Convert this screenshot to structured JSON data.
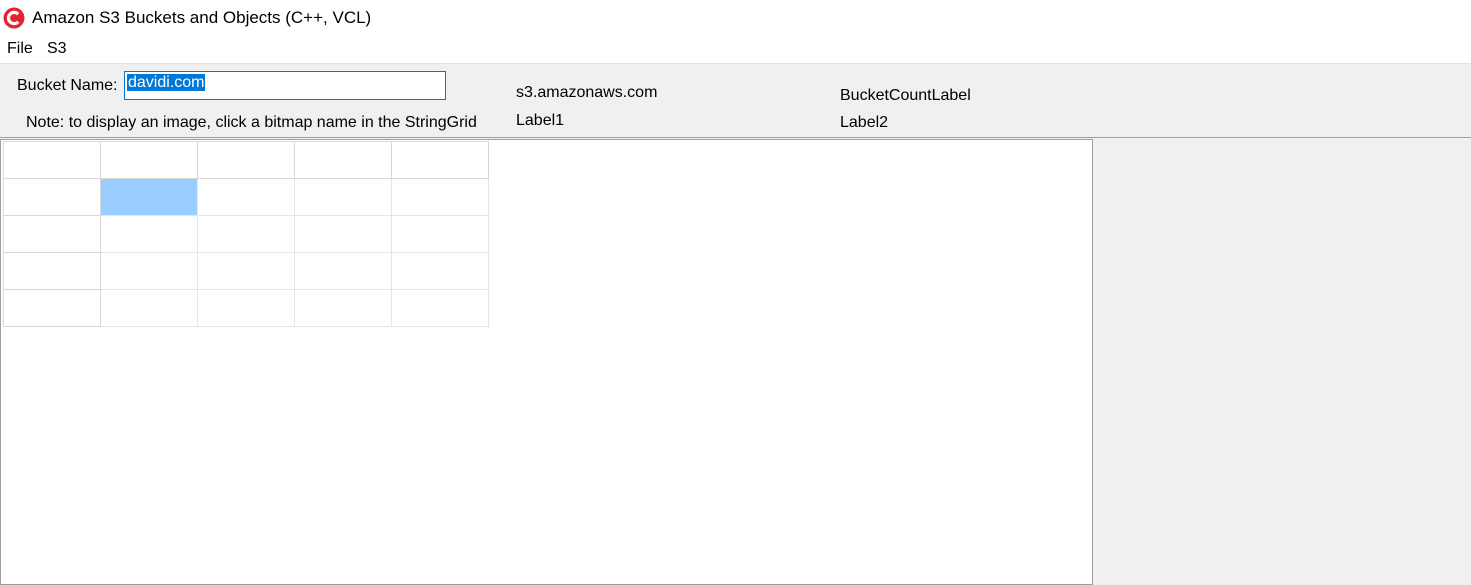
{
  "window": {
    "title": "Amazon S3 Buckets and Objects (C++, VCL)",
    "app_icon": "cbuilder-logo-icon",
    "accent_color": "#e62431"
  },
  "menu": {
    "items": [
      {
        "label": "File"
      },
      {
        "label": "S3"
      }
    ]
  },
  "top_panel": {
    "bucket_name_label": "Bucket Name:",
    "bucket_name_value": "davidi.com",
    "note": "Note: to display an image, click a bitmap name in the StringGrid",
    "host": "s3.amazonaws.com",
    "label1": "Label1",
    "bucket_count_label": "BucketCountLabel",
    "label2": "Label2"
  },
  "string_grid": {
    "rows": [
      [
        "",
        "",
        "",
        "",
        ""
      ],
      [
        "",
        "",
        "",
        "",
        ""
      ],
      [
        "",
        "",
        "",
        "",
        ""
      ],
      [
        "",
        "",
        "",
        "",
        ""
      ],
      [
        "",
        "",
        "",
        "",
        ""
      ]
    ],
    "selected_cell": {
      "row": 1,
      "col": 1
    },
    "selection_color": "#99cdff"
  }
}
